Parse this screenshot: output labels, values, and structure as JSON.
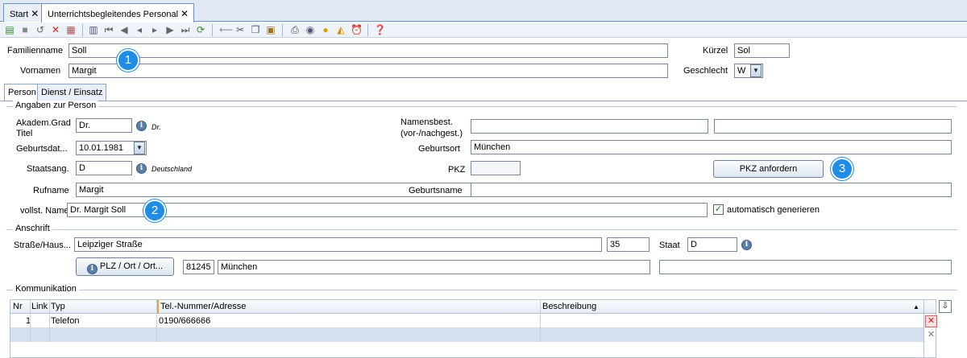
{
  "tabs": [
    {
      "label": "Start"
    },
    {
      "label": "Unterrichtsbegleitendes Personal"
    }
  ],
  "close_glyph": "✕",
  "toolbar_icons": [
    "new-record-icon",
    "save-icon",
    "undo-icon",
    "delete-icon",
    "table-icon",
    "copy-form-icon",
    "first-record-icon",
    "previous-page-icon",
    "previous-record-icon",
    "next-record-icon",
    "next-page-icon",
    "last-record-icon",
    "refresh-icon",
    "back-arrow-icon",
    "cut-icon",
    "copy-icon",
    "paste-icon",
    "print-icon",
    "preview-icon",
    "lightbulb-icon",
    "cleanup-icon",
    "alarm-icon",
    "help-icon"
  ],
  "header": {
    "familienname_label": "Familienname",
    "familienname_value": "Soll",
    "vornamen_label": "Vornamen",
    "vornamen_value": "Margit",
    "kuerzel_label": "Kürzel",
    "kuerzel_value": "Sol",
    "geschlecht_label": "Geschlecht",
    "geschlecht_value": "W"
  },
  "sub_tabs": [
    {
      "label": "Person"
    },
    {
      "label": "Dienst / Einsatz"
    }
  ],
  "person": {
    "group_title": "Angaben zur Person",
    "akad_label_1": "Akadem.Grad",
    "akad_label_2": "Titel",
    "akad_value": "Dr.",
    "akad_hint": "Dr.",
    "geburtsdatum_label": "Geburtsdat...",
    "geburtsdatum_value": "10.01.1981",
    "staatsang_label": "Staatsang.",
    "staatsang_value": "D",
    "staatsang_hint": "Deutschland",
    "rufname_label": "Rufname",
    "rufname_value": "Margit",
    "vollst_label": "vollst. Name",
    "vollst_value": "Dr. Margit  Soll",
    "namensbest_label_1": "Namensbest.",
    "namensbest_label_2": "(vor-/nachgest.)",
    "namensbest_value_1": "",
    "namensbest_value_2": "",
    "geburtsort_label": "Geburtsort",
    "geburtsort_value": "München",
    "pkz_label": "PKZ",
    "pkz_value": "",
    "pkz_button": "PKZ anfordern",
    "geburtsname_label": "Geburtsname",
    "geburtsname_value": "",
    "auto_generate_label": "automatisch generieren",
    "auto_generate_mark": "✓"
  },
  "anschrift": {
    "group_title": "Anschrift",
    "strasse_label": "Straße/Haus...",
    "strasse_value": "Leipziger Straße",
    "hausnr_value": "35",
    "staat_label": "Staat",
    "staat_value": "D",
    "plz_button": "PLZ / Ort / Ort...",
    "plz_value": "81245",
    "ort_value": "München",
    "ortsteil_value": ""
  },
  "kommunikation": {
    "group_title": "Kommunikation",
    "columns": [
      "Nr",
      "Link",
      "Typ",
      "Tel.-Nummer/Adresse",
      "Beschreibung"
    ],
    "rows": [
      {
        "nr": "1",
        "link": "",
        "typ": "Telefon",
        "adresse": "0190/666666",
        "beschreibung": ""
      }
    ]
  },
  "badges": [
    "1",
    "2",
    "3"
  ],
  "dropdown_glyph": "▼",
  "info_glyph": "i",
  "delete_glyph": "✕",
  "sort_glyph": "▲"
}
